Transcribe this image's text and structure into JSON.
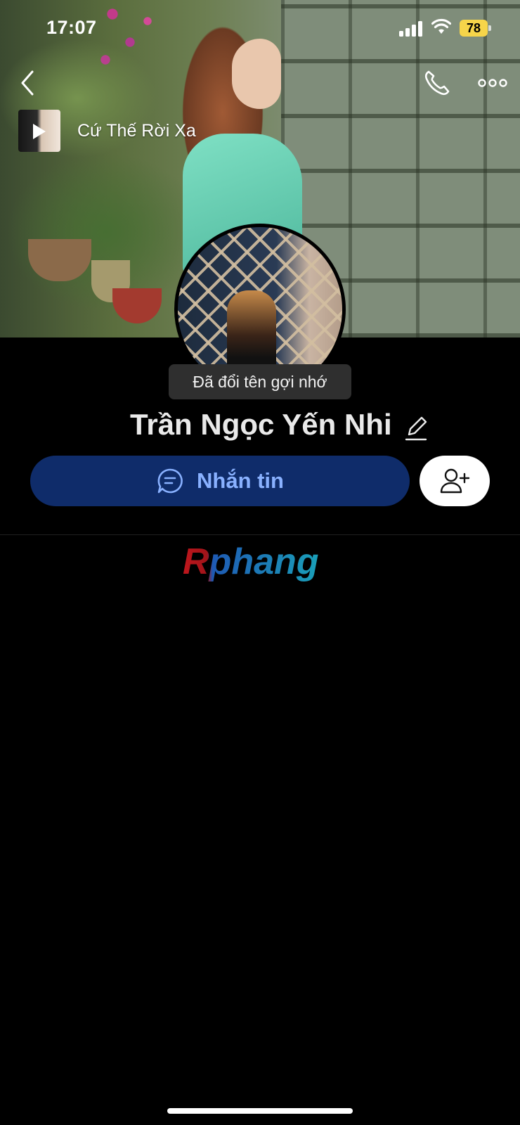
{
  "status_bar": {
    "time": "17:07",
    "battery": "78",
    "battery_color": "#f6d54a"
  },
  "header": {
    "back_icon": "chevron-left-icon",
    "call_icon": "phone-icon",
    "more_icon": "more-horizontal-icon"
  },
  "music": {
    "title": "Cứ Thế Rời Xa",
    "play_icon": "play-icon"
  },
  "toast": {
    "text": "Đã đổi tên gợi nhớ"
  },
  "profile": {
    "name": "Trần Ngọc Yến Nhi",
    "edit_icon": "pencil-icon"
  },
  "actions": {
    "message_label": "Nhắn tin",
    "message_icon": "chat-bubble-icon",
    "add_friend_icon": "add-user-icon",
    "message_bg": "#0f2c6a",
    "message_text_color": "#89b1ff"
  },
  "watermark": {
    "text": "Rphang"
  }
}
